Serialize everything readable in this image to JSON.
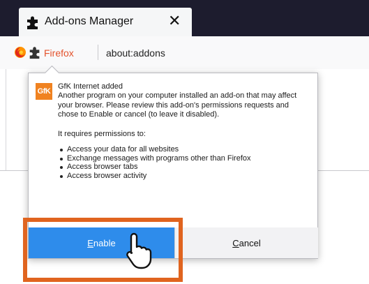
{
  "tab": {
    "title": "Add-ons Manager",
    "close_label": "✕",
    "icon": "puzzle-icon"
  },
  "navbar": {
    "browser_icon": "firefox-icon",
    "page_icon": "puzzle-icon",
    "identity_label": "Firefox",
    "url": "about:addons"
  },
  "popup": {
    "logo_text": "GfK",
    "addon_title": "GfK Internet added",
    "description": "Another program on your computer installed an add-on that may affect your browser. Please review this add-on's permissions requests and chose to Enable or cancel (to leave it disabled).",
    "permissions_header": "It requires permissions to:",
    "permissions": [
      "Access your data for all websites",
      "Exchange messages with programs other than Firefox",
      "Access browser tabs",
      "Access browser activity"
    ],
    "enable_label": "Enable",
    "cancel_label": "Cancel"
  },
  "colors": {
    "titlebar": "#1d1c2e",
    "accent_button": "#2e8ceb",
    "highlight_box": "#e0641f",
    "identity_text": "#e4522c",
    "gfk_logo": "#f08220"
  },
  "overlay": {
    "cursor_icon": "pointer-cursor-icon"
  }
}
